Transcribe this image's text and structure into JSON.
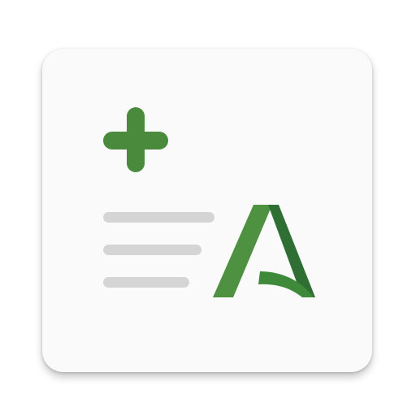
{
  "app_icon": {
    "name": "",
    "card_color": "#fafafa",
    "plus_icon": "plus-icon",
    "plus_color": "#4a8a3c",
    "text_lines_icon": "text-lines-icon",
    "text_line_color": "#d5d5d5",
    "logo_icon": "andalucia-a-logo-icon",
    "logo_colors": {
      "light_green": "#4e9140",
      "dark_green": "#2f6f34"
    }
  }
}
